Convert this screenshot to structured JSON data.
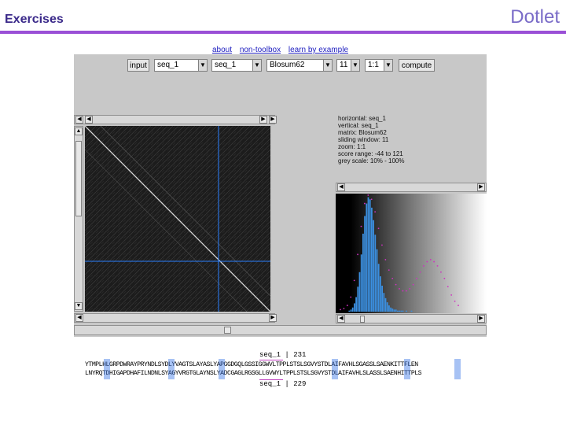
{
  "header": {
    "title": "Exercises",
    "brand": "Dotlet"
  },
  "links": [
    "about",
    "non-toolbox",
    "learn by example"
  ],
  "toolbar": {
    "input_label": "input",
    "seq_h": "seq_1",
    "seq_v": "seq_1",
    "matrix": "Blosum62",
    "window": "11",
    "zoom": "1:1",
    "compute_label": "compute"
  },
  "info": [
    "horizontal: seq_1",
    "vertical: seq_1",
    "matrix: Blosum62",
    "sliding window: 11",
    "zoom: 1:1",
    "score range: -44 to 121",
    "grey scale: 10% - 100%"
  ],
  "sequence": {
    "top_label": "seq_1",
    "top_pos": "231",
    "line1": "YTMPLHLGRPDWRAYPRYNDLSYDLYVAGTSLAYASLYAPGGDGQLGSSIGGWVLTPPLSTSLSGVYSTDLAIFAVHLSGASSLSAENKITTFLEN",
    "line2": "LNYRQTDHIGAPDHAFILNDNLSYAGYVRGTGLAYNSLYADCGAGLRGSGLLGVWYLTPPLSTSLSGVYSTDLAIFAVHLSLASSLSAENHITTPLS",
    "bottom_label": "seq_1",
    "bottom_pos": "229"
  },
  "colors": {
    "accent": "#9a4fd6",
    "crosshair": "#2a7fff",
    "hist_bar": "#3b8fe0",
    "curve": "#d030c0"
  },
  "histogram": {
    "bins": [
      0,
      0,
      1,
      2,
      4,
      8,
      14,
      24,
      38,
      55,
      75,
      92,
      104,
      110,
      108,
      100,
      88,
      74,
      60,
      46,
      34,
      25,
      18,
      13,
      9,
      6,
      4,
      3,
      2,
      2,
      1,
      1,
      1,
      1,
      0,
      1,
      0,
      0,
      1,
      0,
      0,
      0,
      0,
      0
    ],
    "curve": [
      2,
      3,
      6,
      14,
      30,
      55,
      82,
      104,
      112,
      108,
      96,
      80,
      64,
      50,
      40,
      32,
      26,
      22,
      20,
      20,
      22,
      26,
      32,
      38,
      44,
      48,
      50,
      48,
      44,
      38,
      32,
      24,
      16,
      10,
      6
    ]
  }
}
